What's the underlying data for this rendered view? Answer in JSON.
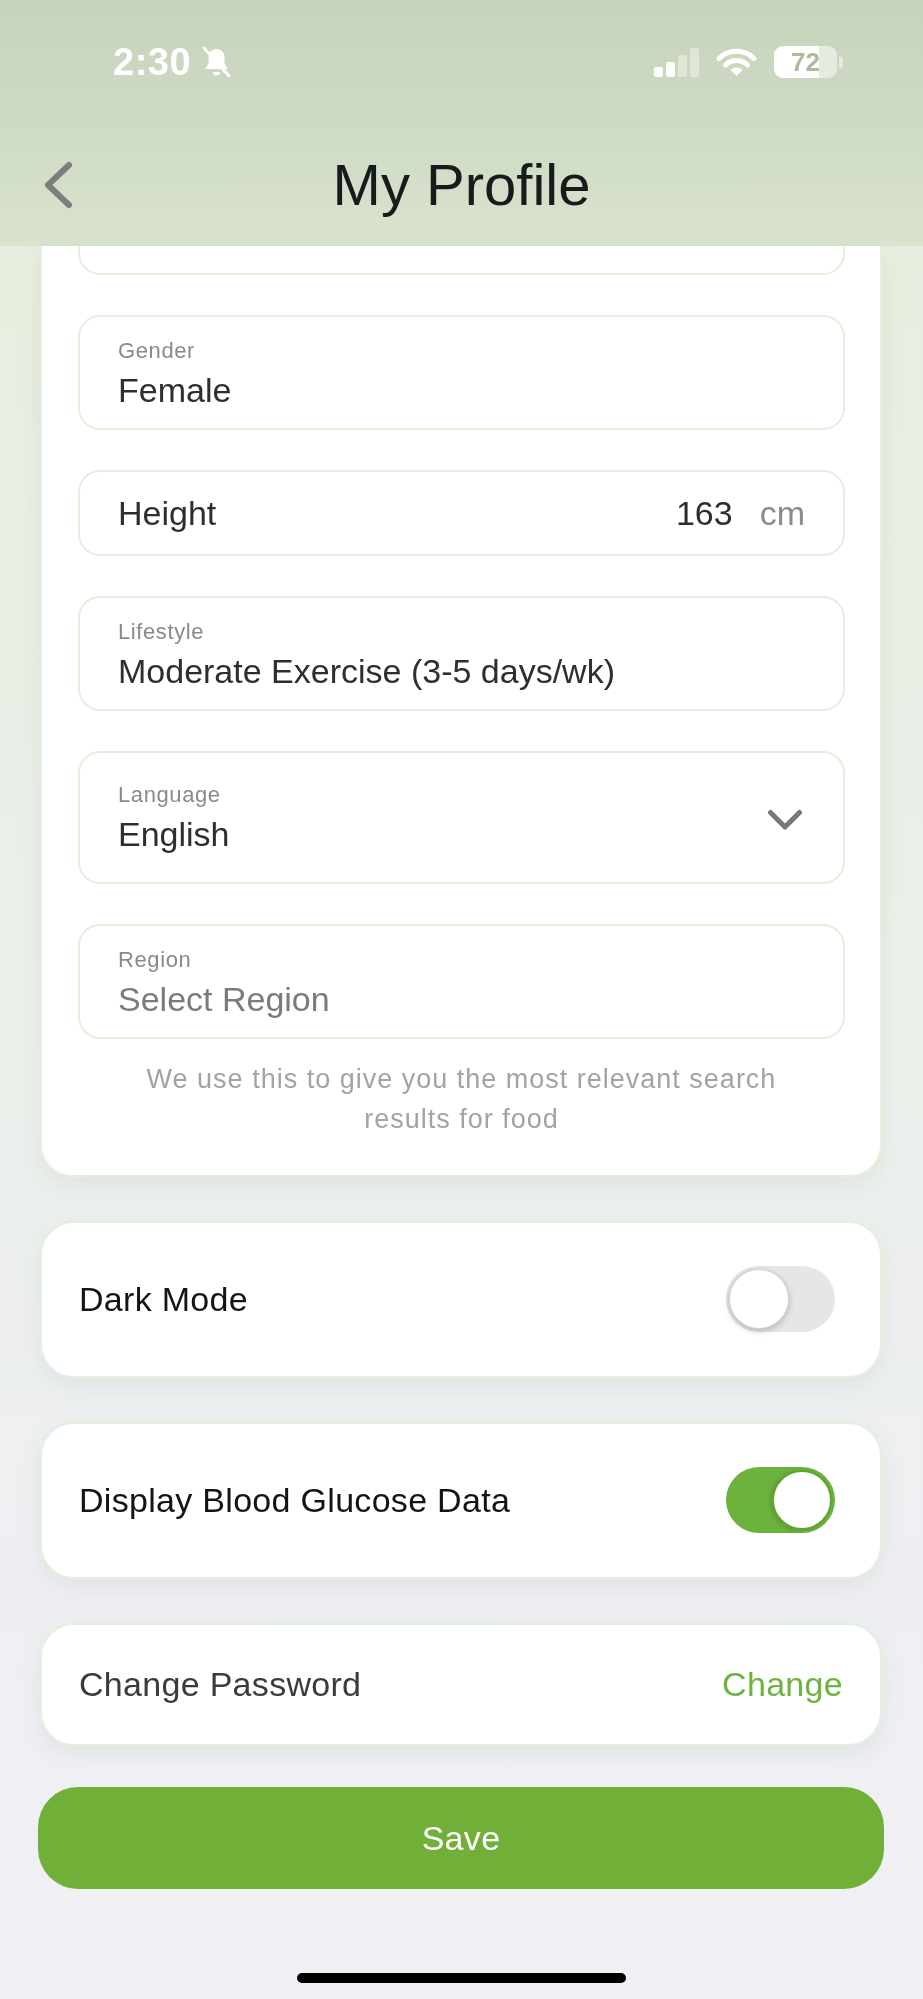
{
  "status_bar": {
    "time": "2:30",
    "silent": true,
    "battery": "72"
  },
  "header": {
    "title": "My Profile"
  },
  "profile_fields": [
    {
      "kind": "clipped"
    },
    {
      "kind": "labeled",
      "label": "Gender",
      "value": "Female"
    },
    {
      "kind": "inline",
      "label": "Height",
      "value": "163",
      "unit": "cm"
    },
    {
      "kind": "labeled",
      "label": "Lifestyle",
      "value": "Moderate Exercise (3-5 days/wk)"
    },
    {
      "kind": "dropdown",
      "label": "Language",
      "value": "English"
    },
    {
      "kind": "labeled",
      "label": "Region",
      "placeholder": "Select Region"
    }
  ],
  "region_note": "We use this to give you the most relevant search results for food",
  "settings": [
    {
      "kind": "toggle",
      "label": "Dark Mode",
      "on": false
    },
    {
      "kind": "toggle",
      "label": "Display Blood Glucose Data",
      "on": true
    },
    {
      "kind": "action",
      "label": "Change Password",
      "action": "Change"
    }
  ],
  "save_button": {
    "label": "Save"
  }
}
